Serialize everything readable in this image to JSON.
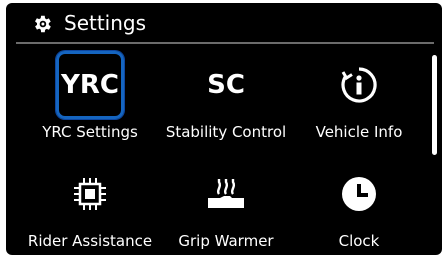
{
  "header": {
    "title": "Settings",
    "icon": "gear-icon"
  },
  "tiles": [
    {
      "label": "YRC Settings",
      "icon_text": "YRC",
      "selected": true
    },
    {
      "label": "Stability Control",
      "icon_text": "SC"
    },
    {
      "label": "Vehicle Info",
      "icon": "info-icon"
    },
    {
      "label": "Rider Assistance",
      "icon": "chip-icon"
    },
    {
      "label": "Grip Warmer",
      "icon": "grip-warmer-icon"
    },
    {
      "label": "Clock",
      "icon": "clock-icon"
    }
  ],
  "colors": {
    "background": "#000000",
    "text": "#ffffff",
    "selection": "#1565c0",
    "divider": "#6b6b6b"
  },
  "scroll": {
    "position": 0.0,
    "visible_fraction": 0.5
  }
}
